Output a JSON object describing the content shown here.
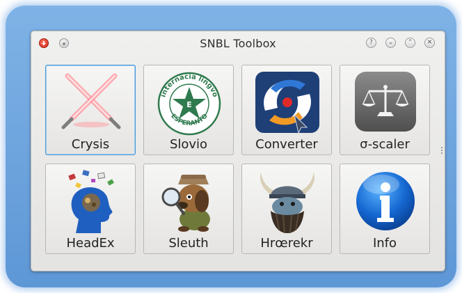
{
  "window": {
    "title": "SNBL Toolbox",
    "left_buttons": [
      {
        "name": "close-icon",
        "color": "#d9301f"
      },
      {
        "name": "menu-dot-icon"
      }
    ],
    "right_buttons": [
      {
        "name": "help-icon",
        "glyph": "?"
      },
      {
        "name": "chevron-down-icon",
        "glyph": "⌄"
      },
      {
        "name": "chevron-up-icon",
        "glyph": "⌃"
      },
      {
        "name": "close-x-icon",
        "glyph": "✕"
      }
    ]
  },
  "tools": [
    {
      "label": "Crysis",
      "icon": "crossed-lightsabers-icon",
      "selected": true
    },
    {
      "label": "Slovio",
      "icon": "esperanto-star-seal-icon",
      "seal_text_top": "internacia lingvo",
      "seal_text_bottom": "ESPERANTO",
      "seal_center": "E"
    },
    {
      "label": "Converter",
      "icon": "converter-swirl-icon"
    },
    {
      "label": "σ-scaler",
      "icon": "balance-scale-icon"
    },
    {
      "label": "HeadEx",
      "icon": "head-profile-icon"
    },
    {
      "label": "Sleuth",
      "icon": "detective-dog-icon"
    },
    {
      "label": "Hrœrekr",
      "icon": "viking-helmet-icon"
    },
    {
      "label": "Info",
      "icon": "info-icon"
    }
  ],
  "colors": {
    "accent_glow": "#6aa3de",
    "selection_border": "#4a9ad6",
    "window_bg": "#ebeae8"
  }
}
